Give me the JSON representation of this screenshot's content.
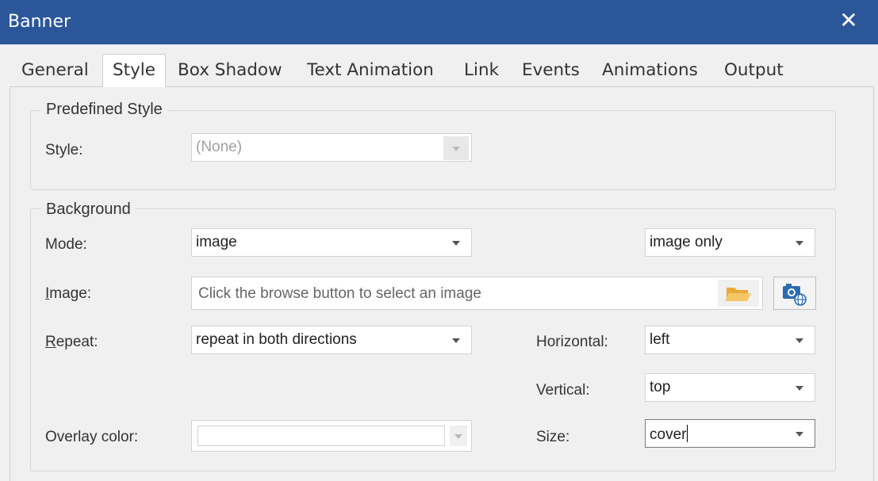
{
  "window": {
    "title": "Banner",
    "close_glyph": "✕"
  },
  "tabs": [
    {
      "label": "General"
    },
    {
      "label": "Style",
      "active": true
    },
    {
      "label": "Box Shadow"
    },
    {
      "label": "Text Animation"
    },
    {
      "label": "Link"
    },
    {
      "label": "Events"
    },
    {
      "label": "Animations"
    },
    {
      "label": "Output"
    }
  ],
  "predefined": {
    "title": "Predefined Style",
    "style_label": "Style:",
    "style_value": "(None)"
  },
  "background": {
    "title": "Background",
    "mode_label": "Mode:",
    "mode_value": "image",
    "mode_option_value": "image only",
    "image_label_first": "I",
    "image_label_rest": "mage:",
    "image_placeholder": "Click the browse button to select an image",
    "repeat_label_first": "R",
    "repeat_label_rest": "epeat:",
    "repeat_value": "repeat in both directions",
    "horizontal_label": "Horizontal:",
    "horizontal_value": "left",
    "vertical_label": "Vertical:",
    "vertical_value": "top",
    "overlay_label": "Overlay color:",
    "size_label": "Size:",
    "size_value": "cover"
  },
  "icons": {
    "close": "close-icon",
    "folder": "folder-open-icon",
    "web_image": "camera-globe-icon"
  },
  "colors": {
    "titlebar": "#2b579a",
    "dialog_bg": "#f0f0f0",
    "folder": "#f0b44c",
    "camera": "#2b6cb0"
  }
}
